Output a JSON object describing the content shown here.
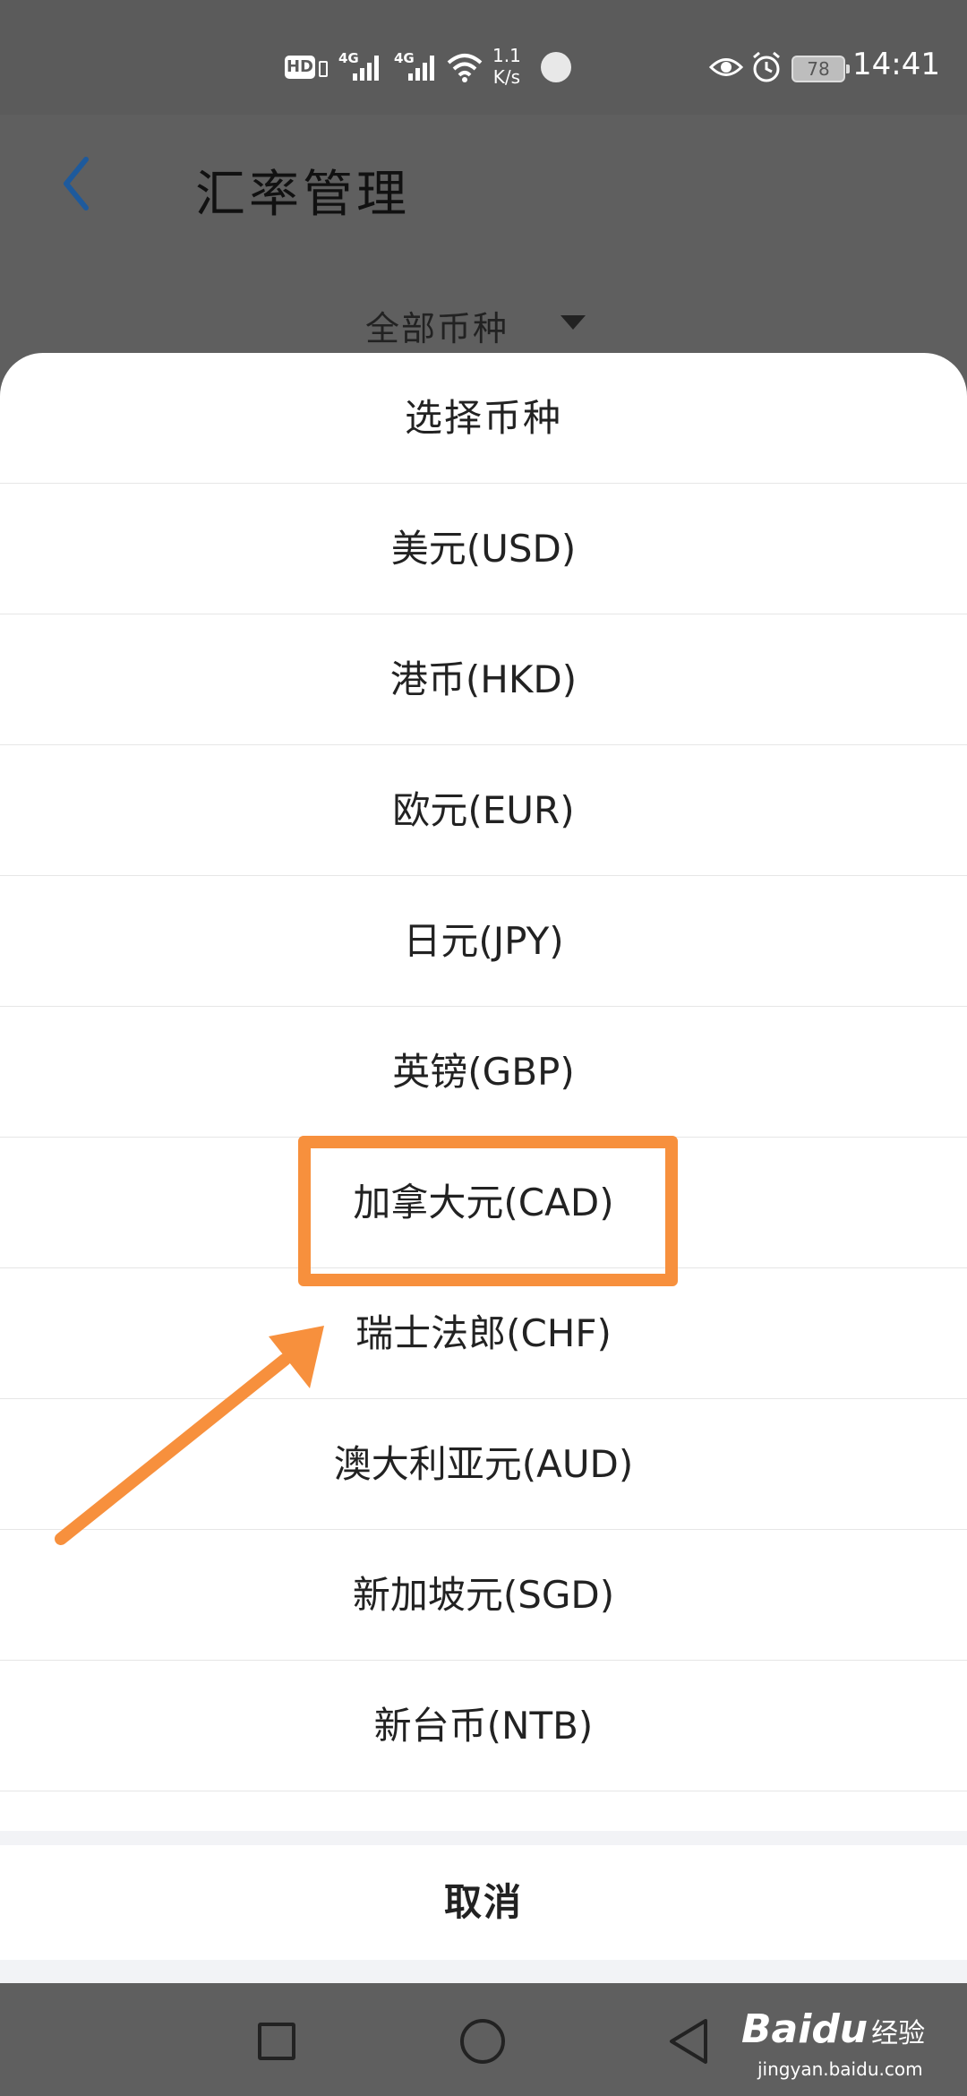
{
  "status_bar": {
    "net_label_1": "4G",
    "net_label_2": "4G",
    "net_speed_value": "1.1",
    "net_speed_unit": "K/s",
    "hd_label": "HD",
    "battery": "78",
    "time": "14:41"
  },
  "header": {
    "title": "汇率管理",
    "filter_label": "全部币种"
  },
  "sheet": {
    "title": "选择币种",
    "options": [
      {
        "label": "美元(USD)"
      },
      {
        "label": "港币(HKD)"
      },
      {
        "label": "欧元(EUR)"
      },
      {
        "label": "日元(JPY)"
      },
      {
        "label": "英镑(GBP)"
      },
      {
        "label": "加拿大元(CAD)"
      },
      {
        "label": "瑞士法郎(CHF)"
      },
      {
        "label": "澳大利亚元(AUD)"
      },
      {
        "label": "新加坡元(SGD)"
      },
      {
        "label": "新台币(NTB)"
      }
    ],
    "cancel_label": "取消"
  },
  "annotation": {
    "highlighted_option": "加拿大元(CAD)",
    "color": "#f7903d"
  },
  "watermark": {
    "logo": "Bai",
    "logo_du": "du",
    "cn": "经验",
    "url": "jingyan.baidu.com"
  },
  "colors": {
    "overlay_bg": "#5f5f5f",
    "sheet_bg": "#ffffff",
    "accent_back": "#1e5a9c",
    "highlight": "#f7903d"
  }
}
